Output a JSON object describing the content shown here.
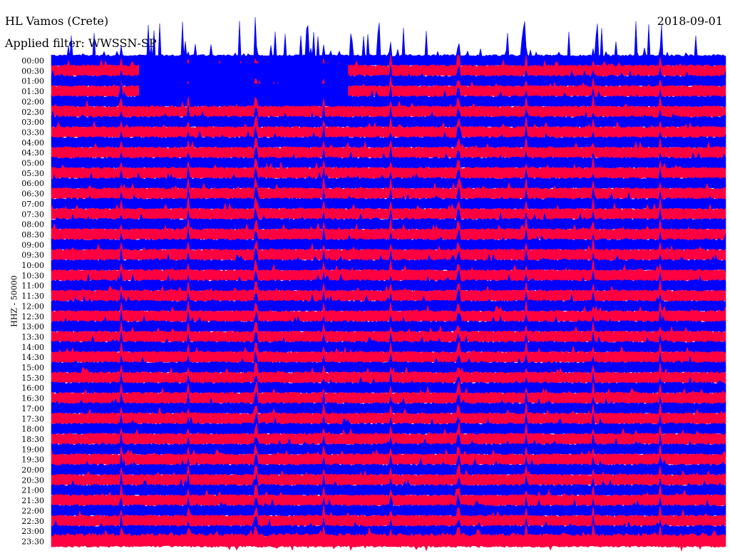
{
  "header": {
    "station": "HL Vamos (Crete)",
    "filter": "Applied filter: WWSSN-SP",
    "date": "2018-09-01"
  },
  "chart_data": {
    "type": "line",
    "title": "HL Vamos (Crete)",
    "subtitle": "Applied filter: WWSSN-SP",
    "ylabel": "HHZ - 50000",
    "xlabel": "",
    "minutes_per_row": 30,
    "row_labels": [
      "00:00",
      "00:30",
      "01:00",
      "01:30",
      "02:00",
      "02:30",
      "03:00",
      "03:30",
      "04:00",
      "04:30",
      "05:00",
      "05:30",
      "06:00",
      "06:30",
      "07:00",
      "07:30",
      "08:00",
      "08:30",
      "09:00",
      "09:30",
      "10:00",
      "10:30",
      "11:00",
      "11:30",
      "12:00",
      "12:30",
      "13:00",
      "13:30",
      "14:00",
      "14:30",
      "15:00",
      "15:30",
      "16:00",
      "16:30",
      "17:00",
      "17:30",
      "18:00",
      "18:30",
      "19:00",
      "19:30",
      "20:00",
      "20:30",
      "21:00",
      "21:30",
      "22:00",
      "22:30",
      "23:00",
      "23:30"
    ],
    "series_colors": [
      "#0000ff",
      "#ff0040"
    ],
    "spike_minutes": [
      3.1,
      6.1,
      9.1,
      12.1,
      15.1,
      18.1,
      21.1,
      24.1,
      27.1
    ],
    "saturated_interval": {
      "rows": [
        "00:30",
        "01:00",
        "01:30"
      ],
      "start_minute": 3.9,
      "end_minute": 13.2
    }
  }
}
